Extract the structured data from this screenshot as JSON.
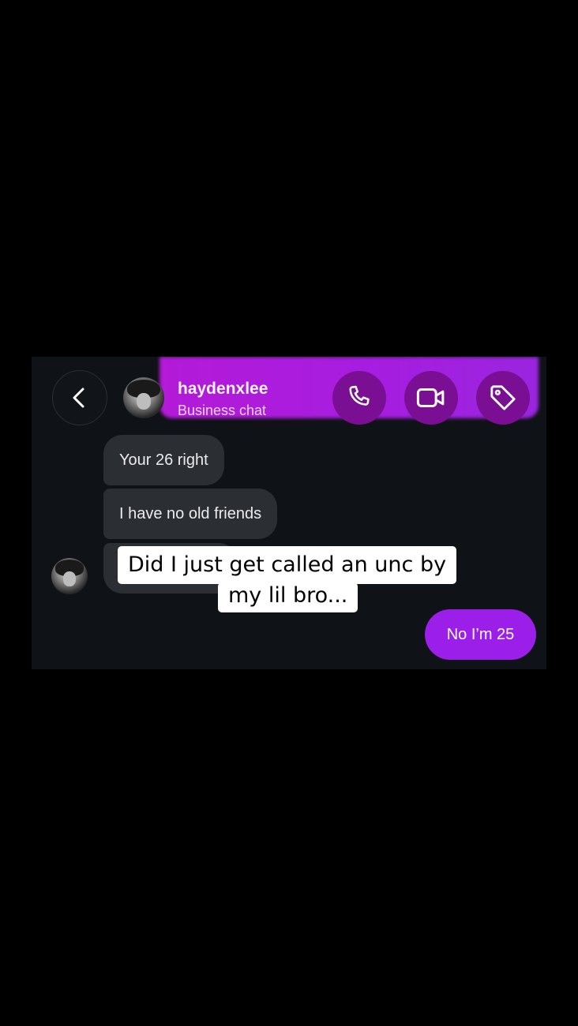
{
  "header": {
    "username": "haydenxlee",
    "subtitle": "Business chat",
    "back_icon": "chevron-left-icon",
    "call_icon": "phone-icon",
    "video_icon": "video-camera-icon",
    "tag_icon": "tag-icon",
    "accent_color": "#9b1fe8"
  },
  "messages": {
    "incoming": [
      "Your 26 right",
      "I have no old friends"
    ],
    "outgoing": [
      "No I’m 25"
    ]
  },
  "overlay_caption": {
    "line1": "Did I just get called an unc by",
    "line2": "my lil bro..."
  }
}
